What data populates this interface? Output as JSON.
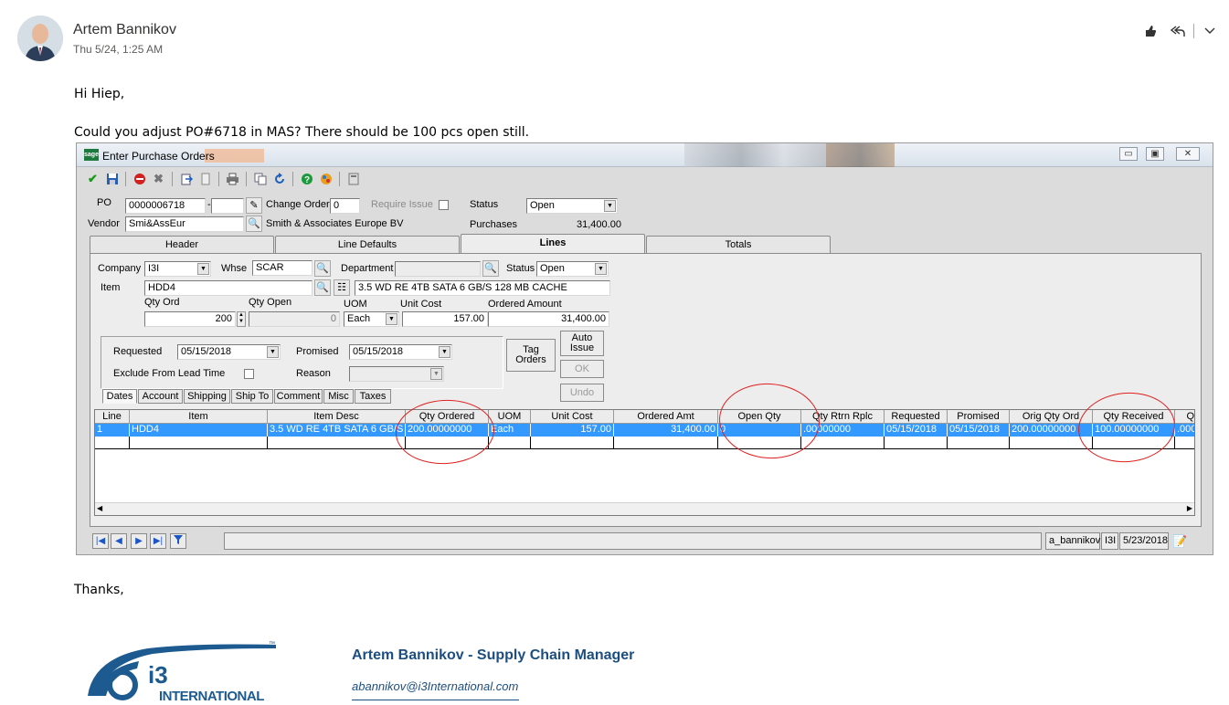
{
  "email": {
    "sender": "Artem Bannikov",
    "date": "Thu 5/24, 1:25 AM",
    "greeting": "Hi Hiep,",
    "message": "Could you adjust PO#6718 in MAS? There should be 100 pcs open still.",
    "closing": "Thanks,",
    "actions": {
      "like_icon": "thumbs-up-icon",
      "reply_all_icon": "reply-all-icon",
      "more_icon": "chevron-down-icon"
    }
  },
  "app": {
    "title": "Enter Purchase Orders",
    "logo_text": "sage",
    "window_controls": {
      "minimize": "▭",
      "restore": "▣",
      "close": "✕"
    },
    "header": {
      "po_label": "PO",
      "po_value": "0000006718",
      "po_dash": "-",
      "change_order_label": "Change Order",
      "change_order_value": "0",
      "require_issue_label": "Require Issue",
      "status_label": "Status",
      "status_value": "Open",
      "vendor_label": "Vendor",
      "vendor_code": "Smi&AssEur",
      "vendor_name": "Smith & Associates Europe BV",
      "purchases_label": "Purchases",
      "purchases_value": "31,400.00"
    },
    "tabs": [
      "Header",
      "Line Defaults",
      "Lines",
      "Totals"
    ],
    "active_tab": "Lines",
    "lines": {
      "company_label": "Company",
      "company_value": "I3I",
      "whse_label": "Whse",
      "whse_value": "SCAR",
      "department_label": "Department",
      "department_value": "",
      "status_label": "Status",
      "status_value": "Open",
      "item_label": "Item",
      "item_value": "HDD4",
      "item_desc": "3.5 WD RE 4TB SATA 6 GB/S 128 MB CACHE",
      "qty_ord_label": "Qty Ord",
      "qty_ord_value": "200",
      "qty_open_label": "Qty Open",
      "qty_open_value": "0",
      "uom_label": "UOM",
      "uom_value": "Each",
      "unit_cost_label": "Unit Cost",
      "unit_cost_value": "157.00",
      "ordered_amount_label": "Ordered Amount",
      "ordered_amount_value": "31,400.00",
      "requested_label": "Requested",
      "requested_value": "05/15/2018",
      "promised_label": "Promised",
      "promised_value": "05/15/2018",
      "exclude_label": "Exclude  From Lead Time",
      "reason_label": "Reason",
      "reason_value": "",
      "tag_orders_button": "Tag Orders",
      "auto_issue_button": "Auto Issue",
      "ok_button": "OK",
      "undo_button": "Undo",
      "subtabs": [
        "Dates",
        "Account",
        "Shipping",
        "Ship To",
        "Comment",
        "Misc",
        "Taxes"
      ]
    },
    "grid": {
      "columns": [
        "Line",
        "Item",
        "Item Desc",
        "Qty Ordered",
        "UOM",
        "Unit Cost",
        "Ordered Amt",
        "Open Qty",
        "Qty Rtrn Rplc",
        "Requested",
        "Promised",
        "Orig Qty Ord",
        "Qty Received",
        "Q"
      ],
      "rows": [
        [
          "1",
          "HDD4",
          "3.5 WD RE 4TB SATA 6 GB/S 1",
          "200.00000000",
          "Each",
          "157.00",
          "31,400.00",
          "0",
          ".00000000",
          "05/15/2018",
          "05/15/2018",
          "200.00000000",
          "100.00000000",
          ".000"
        ]
      ]
    },
    "statusbar": {
      "nav_icons": [
        "first-record-icon",
        "previous-record-icon",
        "next-record-icon",
        "last-record-icon",
        "filter-icon"
      ],
      "user": "a_bannikov",
      "company": "I3I",
      "date": "5/23/2018"
    }
  },
  "signature": {
    "logo_text": "INTERNATIONAL",
    "logo_mark": "i3",
    "tm": "™",
    "name_title": "Artem Bannikov - Supply Chain Manager",
    "email": "abannikov@i3International.com"
  },
  "colors": {
    "selection": "#3399ff",
    "annotation": "#e02020",
    "signature_blue": "#1c4e82"
  }
}
